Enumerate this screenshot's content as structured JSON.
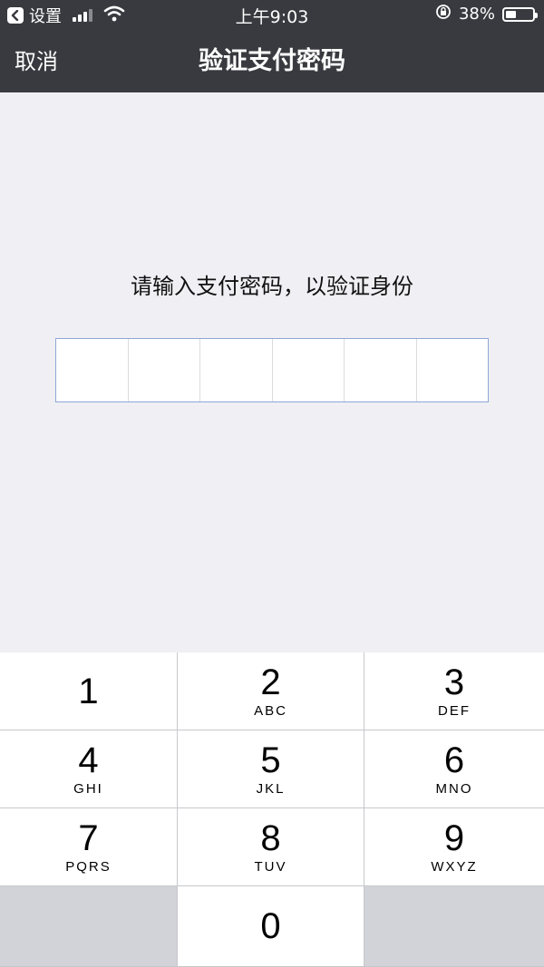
{
  "status_bar": {
    "back_app": "设置",
    "time": "上午9:03",
    "battery_percent": "38%",
    "battery_level": 0.38
  },
  "nav": {
    "cancel_label": "取消",
    "title": "验证支付密码"
  },
  "prompt": "请输入支付密码，以验证身份",
  "pin_length": 6,
  "keypad": {
    "keys": [
      {
        "digit": "1",
        "letters": ""
      },
      {
        "digit": "2",
        "letters": "ABC"
      },
      {
        "digit": "3",
        "letters": "DEF"
      },
      {
        "digit": "4",
        "letters": "GHI"
      },
      {
        "digit": "5",
        "letters": "JKL"
      },
      {
        "digit": "6",
        "letters": "MNO"
      },
      {
        "digit": "7",
        "letters": "PQRS"
      },
      {
        "digit": "8",
        "letters": "TUV"
      },
      {
        "digit": "9",
        "letters": "WXYZ"
      },
      {
        "digit": "",
        "letters": ""
      },
      {
        "digit": "0",
        "letters": ""
      },
      {
        "digit": "",
        "letters": ""
      }
    ]
  },
  "colors": {
    "nav_background": "#393a3f",
    "page_background": "#efeff4",
    "pin_border": "#8fa6d8"
  }
}
